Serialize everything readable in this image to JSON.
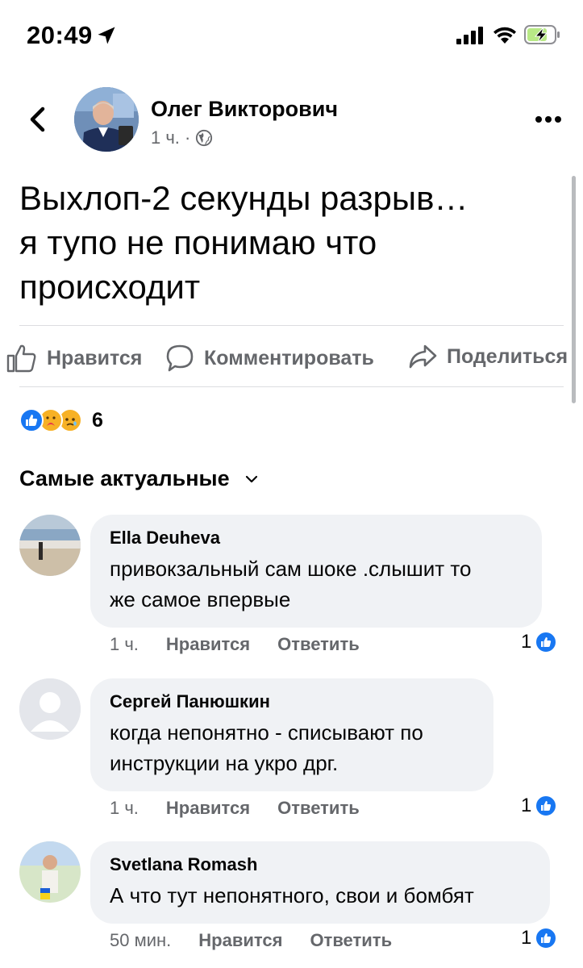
{
  "status_bar": {
    "time": "20:49"
  },
  "post": {
    "author": "Олег Викторович",
    "time": "1 ч. ·",
    "text_lines": [
      "Выхлоп-2 секунды разрыв…",
      "я тупо не понимаю что",
      "происходит"
    ]
  },
  "actions": {
    "like": "Нравится",
    "comment": "Комментировать",
    "share": "Поделиться"
  },
  "reactions": {
    "count": "6"
  },
  "sort": {
    "label": "Самые актуальные"
  },
  "comments": [
    {
      "author": "Ella Deuheva",
      "text_lines": [
        "привокзальный сам шоке .слышит то",
        "же самое впервые"
      ],
      "time": "1 ч.",
      "like_label": "Нравится",
      "reply_label": "Ответить",
      "likes": "1"
    },
    {
      "author": "Сергей Панюшкин",
      "text_lines": [
        "когда непонятно - списывают по",
        "инструкции на укро дрг."
      ],
      "time": "1 ч.",
      "like_label": "Нравится",
      "reply_label": "Ответить",
      "likes": "1"
    },
    {
      "author": "Svetlana Romash",
      "text_lines": [
        "А что тут непонятного, свои и бомбят"
      ],
      "time": "50 мин.",
      "like_label": "Нравится",
      "reply_label": "Ответить",
      "likes": "1"
    }
  ],
  "colors": {
    "accent": "#1877f2",
    "secondary_text": "#65676b",
    "bubble": "#f0f2f5"
  }
}
